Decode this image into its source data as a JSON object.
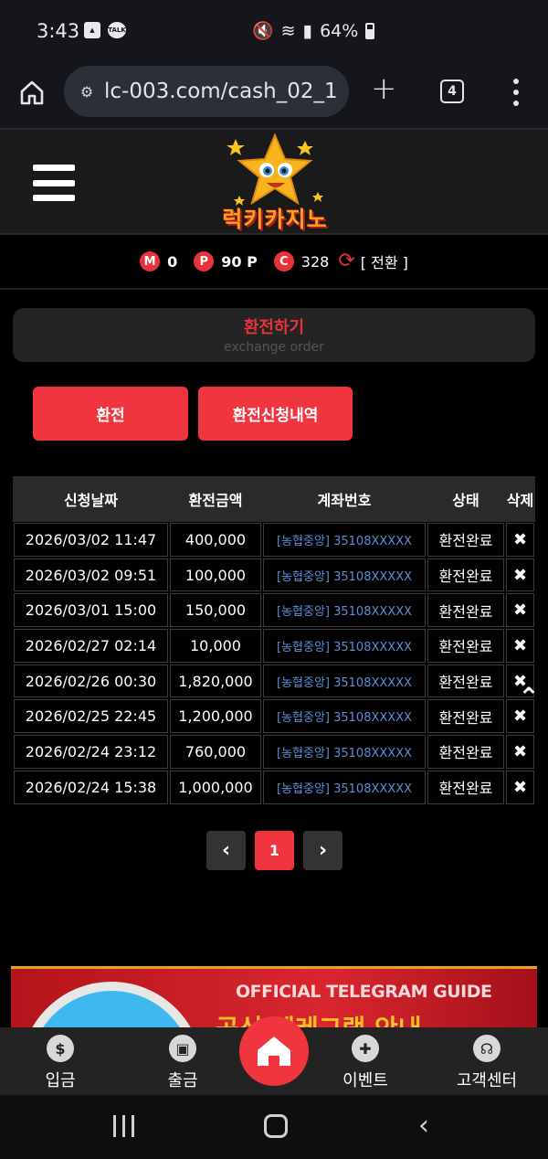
{
  "status_bar": {
    "time": "3:43",
    "battery": "64%"
  },
  "browser": {
    "url": "lc-003.com/cash_02_1",
    "tab_count": "4"
  },
  "site": {
    "logo_text": "럭키카지노"
  },
  "points": {
    "m_label": "M",
    "m_value": "0",
    "p_label": "P",
    "p_value": "90 P",
    "c_label": "C",
    "c_value": "328",
    "convert_label": "[ 전환 ]"
  },
  "page": {
    "title": "환전하기",
    "subtitle": "exchange order"
  },
  "tabs": [
    {
      "label": "환전"
    },
    {
      "label": "환전신청내역"
    }
  ],
  "table": {
    "headers": [
      "신청날짜",
      "환전금액",
      "계좌번호",
      "상태",
      "삭제"
    ],
    "rows": [
      {
        "date": "2026/03/02 11:47",
        "amount": "400,000",
        "account": "[농협중앙] 35108XXXXX",
        "status": "환전완료"
      },
      {
        "date": "2026/03/02 09:51",
        "amount": "100,000",
        "account": "[농협중앙] 35108XXXXX",
        "status": "환전완료"
      },
      {
        "date": "2026/03/01 15:00",
        "amount": "150,000",
        "account": "[농협중앙] 35108XXXXX",
        "status": "환전완료"
      },
      {
        "date": "2026/02/27 02:14",
        "amount": "10,000",
        "account": "[농협중앙] 35108XXXXX",
        "status": "환전완료"
      },
      {
        "date": "2026/02/26 00:30",
        "amount": "1,820,000",
        "account": "[농협중앙] 35108XXXXX",
        "status": "환전완료"
      },
      {
        "date": "2026/02/25 22:45",
        "amount": "1,200,000",
        "account": "[농협중앙] 35108XXXXX",
        "status": "환전완료"
      },
      {
        "date": "2026/02/24 23:12",
        "amount": "760,000",
        "account": "[농협중앙] 35108XXXXX",
        "status": "환전완료"
      },
      {
        "date": "2026/02/24 15:38",
        "amount": "1,000,000",
        "account": "[농협중앙] 35108XXXXX",
        "status": "환전완료"
      }
    ]
  },
  "pagination": {
    "current": "1"
  },
  "banner": {
    "title": "OFFICIAL TELEGRAM GUIDE",
    "subtitle": "공식 텔레그램 안내"
  },
  "bottom_nav": [
    {
      "label": "입금",
      "icon": "deposit-icon"
    },
    {
      "label": "출금",
      "icon": "withdraw-icon"
    },
    {
      "label": "이벤트",
      "icon": "gift-icon"
    },
    {
      "label": "고객센터",
      "icon": "headset-icon"
    }
  ],
  "colors": {
    "accent": "#f0353f",
    "account_link": "#5b8fd6"
  }
}
